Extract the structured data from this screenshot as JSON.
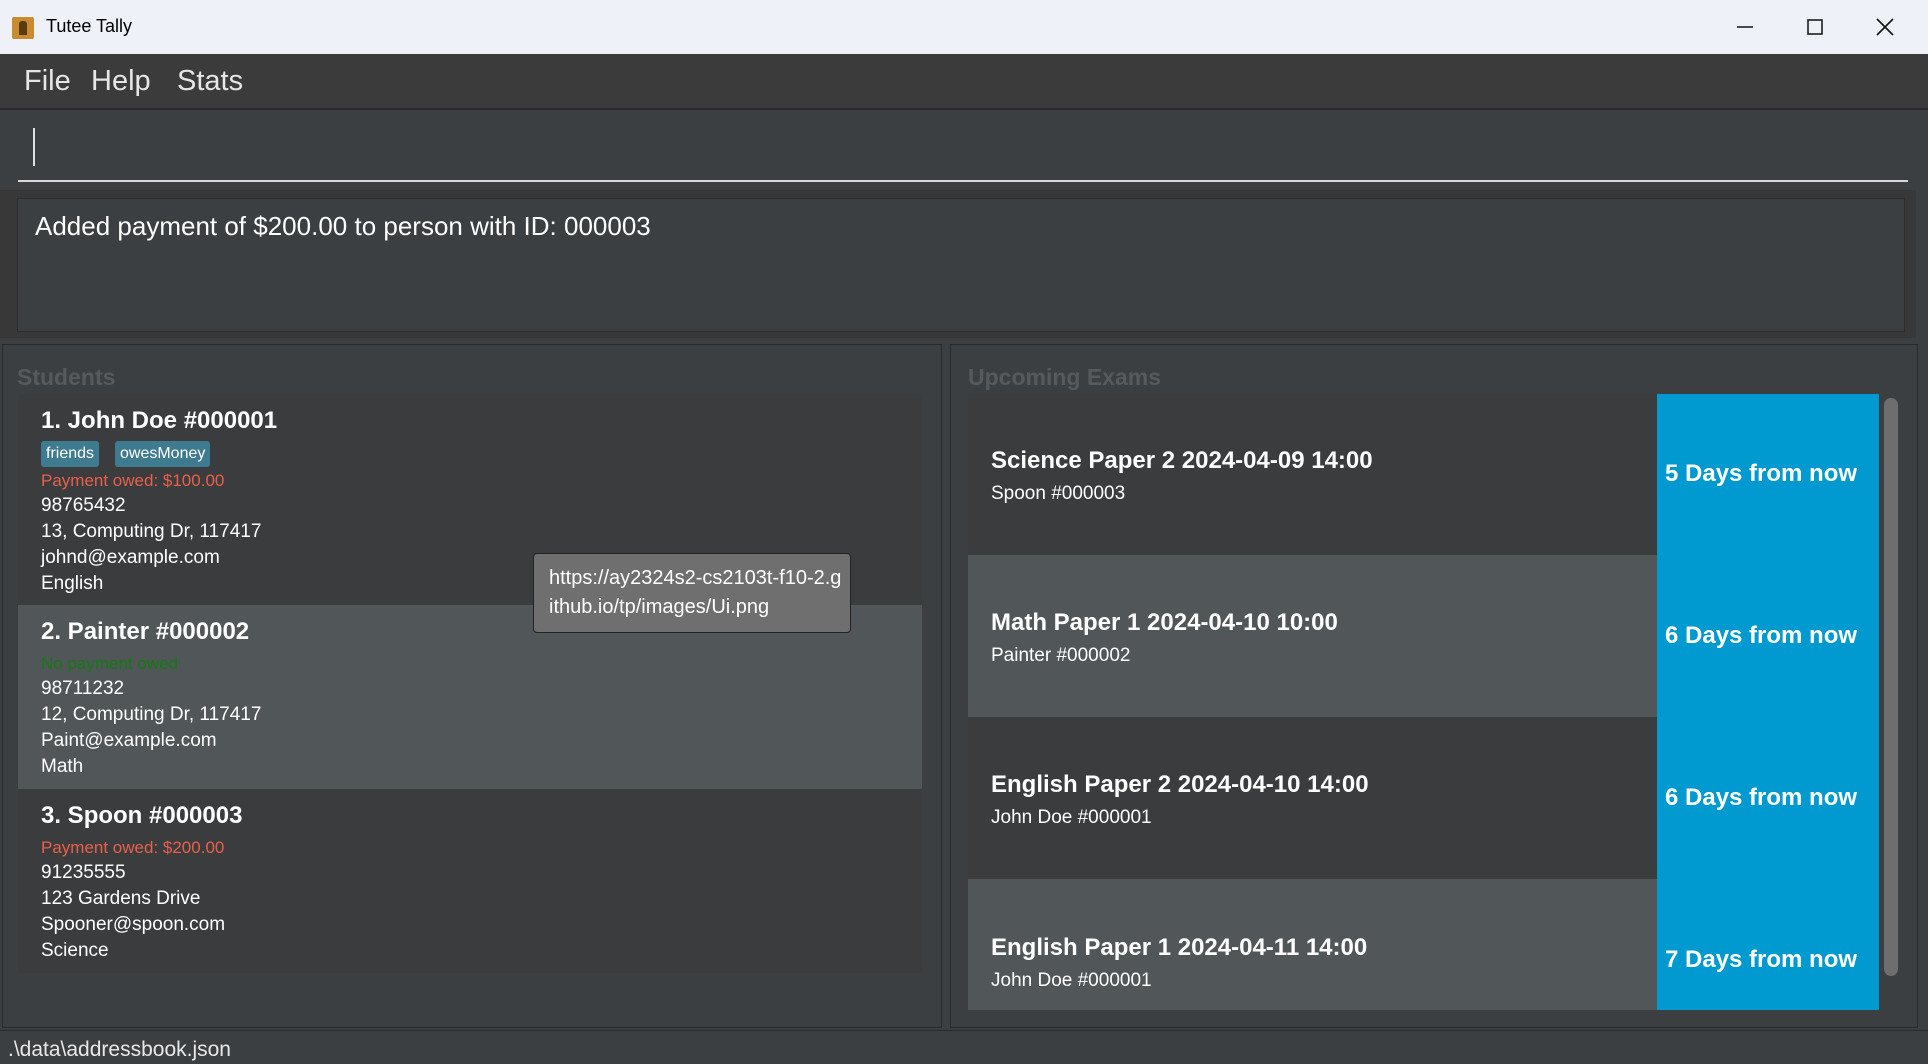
{
  "window": {
    "title": "Tutee Tally",
    "minimize_label": "—",
    "close_label": "✕"
  },
  "menu": {
    "file": "File",
    "help": "Help",
    "stats": "Stats"
  },
  "command": {
    "value": "",
    "placeholder": ""
  },
  "result": {
    "message": "Added payment of $200.00 to person with ID: 000003"
  },
  "students_panel": {
    "label": "Students",
    "items": [
      {
        "title": "1.  John Doe   #000001",
        "tags": [
          "friends",
          "owesMoney"
        ],
        "payment": "Payment owed: $100.00",
        "phone": "98765432",
        "address": "13, Computing Dr, 117417",
        "email": "johnd@example.com",
        "subject": "English"
      },
      {
        "title": "2.  Painter   #000002",
        "payment": "No payment owed",
        "phone": "98711232",
        "address": "12, Computing Dr, 117417",
        "email": "Paint@example.com",
        "subject": "Math"
      },
      {
        "title": "3.  Spoon   #000003",
        "payment": "Payment owed: $200.00",
        "phone": "91235555",
        "address": "123 Gardens Drive",
        "email": "Spooner@spoon.com",
        "subject": "Science"
      }
    ]
  },
  "exams_panel": {
    "label": "Upcoming Exams",
    "items": [
      {
        "title": "Science Paper 2 2024-04-09 14:00",
        "student": "Spoon   #000003",
        "days": "5 Days from now"
      },
      {
        "title": "Math Paper 1 2024-04-10 10:00",
        "student": "Painter   #000002",
        "days": "6 Days from now"
      },
      {
        "title": "English Paper 2  2024-04-10 14:00",
        "student": "John Doe   #000001",
        "days": "6 Days from now"
      },
      {
        "title": "English Paper 1 2024-04-11 14:00",
        "student": "John Doe   #000001",
        "days": "7 Days from now"
      }
    ]
  },
  "tooltip": {
    "text": "https://ay2324s2-cs2103t-f10-2.github.io/tp/images/Ui.png"
  },
  "status": {
    "path": ".\\data\\addressbook.json"
  },
  "colors": {
    "accent_blue": "#0099d0",
    "tag_bg": "#3e7b91",
    "owed_red": "#e8604c",
    "no_owed_green": "#127a12"
  }
}
